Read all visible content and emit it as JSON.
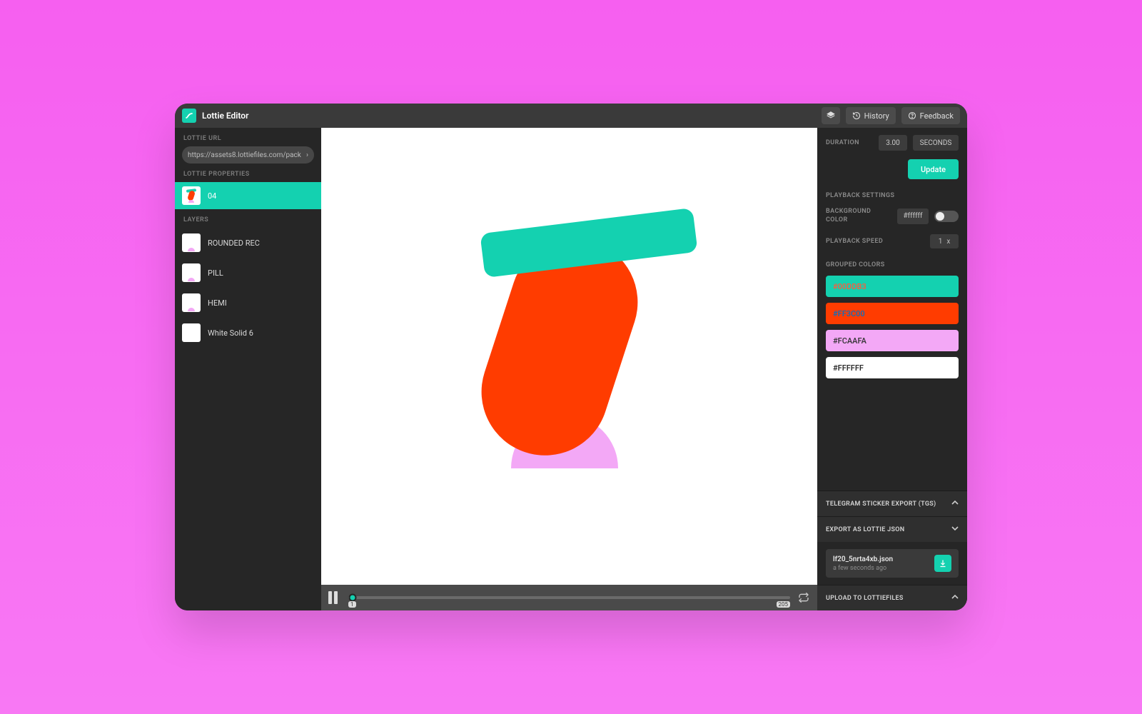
{
  "header": {
    "title": "Lottie Editor",
    "history_label": "History",
    "feedback_label": "Feedback"
  },
  "left": {
    "url_label": "LOTTIE URL",
    "url_value": "https://assets8.lottiefiles.com/pack",
    "properties_label": "LOTTIE PROPERTIES",
    "property_name": "04",
    "layers_label": "LAYERS",
    "layers": [
      {
        "name": "ROUNDED REC"
      },
      {
        "name": "PILL"
      },
      {
        "name": "HEMI"
      },
      {
        "name": "White Solid 6"
      }
    ]
  },
  "timeline": {
    "start_frame": "1",
    "end_frame": "205"
  },
  "right": {
    "duration_label": "DURATION",
    "duration_value": "3.00",
    "duration_unit": "SECONDS",
    "update_label": "Update",
    "playback_label": "PLAYBACK SETTINGS",
    "bg_label": "BACKGROUND COLOR",
    "bg_value": "#ffffff",
    "speed_label": "PLAYBACK SPEED",
    "speed_value": "1",
    "speed_suffix": "x",
    "grouped_label": "GROUPED COLORS",
    "swatches": [
      {
        "hex": "#00DDB3",
        "bg": "#14d1b0",
        "fg": "#ff5a3c"
      },
      {
        "hex": "#FF3C00",
        "bg": "#ff3c00",
        "fg": "#0a6fbf"
      },
      {
        "hex": "#FCAAFA",
        "bg": "#f3a8f6",
        "fg": "#333333"
      },
      {
        "hex": "#FFFFFF",
        "bg": "#ffffff",
        "fg": "#222222"
      }
    ],
    "tgs_label": "TELEGRAM STICKER EXPORT (TGS)",
    "export_json_label": "EXPORT AS LOTTIE JSON",
    "export_file": "lf20_5nrta4xb.json",
    "export_time": "a few seconds ago",
    "upload_label": "UPLOAD TO LOTTIEFILES"
  }
}
